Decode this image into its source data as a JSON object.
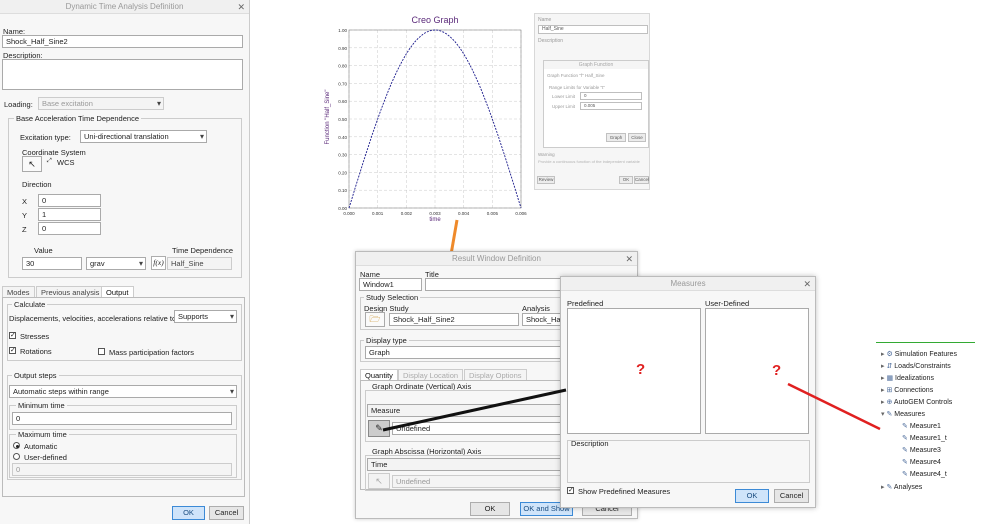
{
  "left_dialog": {
    "title": "Dynamic Time Analysis Definition",
    "name_label": "Name:",
    "name_value": "Shock_Half_Sine2",
    "description_label": "Description:",
    "loading_label": "Loading:",
    "loading_value": "Base excitation",
    "group_title": "Base Acceleration Time Dependence",
    "excitation_label": "Excitation type:",
    "excitation_value": "Uni-directional translation",
    "coord_label": "Coordinate System",
    "coord_value": "WCS",
    "direction_label": "Direction",
    "x_label": "X",
    "x_value": "0",
    "y_label": "Y",
    "y_value": "1",
    "z_label": "Z",
    "z_value": "0",
    "value_label": "Value",
    "value_value": "30",
    "unit_value": "grav",
    "time_dep_label": "Time Dependence",
    "time_dep_value": "Half_Sine",
    "fx_label": "f(x)",
    "tabs": [
      "Modes",
      "Previous analysis",
      "Output"
    ],
    "calculate_title": "Calculate",
    "relative_label": "Displacements, velocities, accelerations relative to:",
    "relative_value": "Supports",
    "stresses_label": "Stresses",
    "rotations_label": "Rotations",
    "mass_label": "Mass participation factors",
    "output_steps_title": "Output steps",
    "output_steps_value": "Automatic steps within range",
    "min_time_title": "Minimum time",
    "min_time_value": "0",
    "max_time_title": "Maximum time",
    "automatic_label": "Automatic",
    "user_defined_label": "User-defined",
    "max_time_value": "0",
    "ok_label": "OK",
    "cancel_label": "Cancel"
  },
  "graph": {
    "title": "Creo Graph",
    "ylabel": "Function \"Half_Sine\"",
    "xlabel": "time",
    "y_ticks": [
      "0.00",
      "0.10",
      "0.20",
      "0.30",
      "0.40",
      "0.50",
      "0.60",
      "0.70",
      "0.80",
      "0.90",
      "1.00"
    ],
    "x_ticks": [
      "0.000",
      "0.001",
      "0.002",
      "0.003",
      "0.004",
      "0.005",
      "0.006"
    ]
  },
  "right_ghost": {
    "name_label": "Name",
    "name_value": "Half_Sine",
    "desc_label": "Description",
    "dialog_title": "Graph Function",
    "graph_fn_label": "Graph Function \"f\" Half_Sine",
    "range_label": "Range Limits for Variable \"t\"",
    "lower_label": "Lower Limit",
    "lower_value": "0",
    "upper_label": "Upper Limit",
    "upper_value": "0.005",
    "graph_btn": "Graph",
    "close_btn": "Close",
    "warning_label": "Warning",
    "warning_text": "Provide a continuous function of the independent variable",
    "review_btn": "Review",
    "ok_btn": "OK",
    "cancel_btn": "Cancel"
  },
  "result_window": {
    "title": "Result Window Definition",
    "name_label": "Name",
    "name_value": "Window1",
    "title_label": "Title",
    "study_sel_title": "Study Selection",
    "design_study_label": "Design Study",
    "design_study_value": "Shock_Half_Sine2",
    "analysis_label": "Analysis",
    "analysis_value": "Shock_Half",
    "display_type_title": "Display type",
    "display_type_value": "Graph",
    "tabs": [
      "Quantity",
      "Display Location",
      "Display Options"
    ],
    "ordinate_title": "Graph Ordinate (Vertical) Axis",
    "measure_label": "Measure",
    "undefined_label": "Undefined",
    "abscissa_title": "Graph Abscissa (Horizontal) Axis",
    "time_label": "Time",
    "undefined2_label": "Undefined",
    "ok_btn": "OK",
    "ok_show_btn": "OK and Show",
    "cancel_btn": "Cancel"
  },
  "measures": {
    "title": "Measures",
    "predefined_label": "Predefined",
    "user_defined_label": "User-Defined",
    "question_mark": "?",
    "description_label": "Description",
    "show_predef_label": "Show Predefined Measures",
    "ok_btn": "OK",
    "cancel_btn": "Cancel"
  },
  "outside_question": "?",
  "tree": {
    "items": [
      "Simulation Features",
      "Loads/Constraints",
      "Idealizations",
      "Connections",
      "AutoGEM Controls",
      "Measures",
      "Measure1",
      "Measure1_t",
      "Measure3",
      "Measure4",
      "Measure4_t",
      "Analyses"
    ]
  },
  "colors": {
    "accent": "#3c8ad6",
    "red": "#e02020",
    "orange": "#ef8a2a",
    "tree_line": "#33aa33",
    "graph_line": "#1a1a8c"
  }
}
